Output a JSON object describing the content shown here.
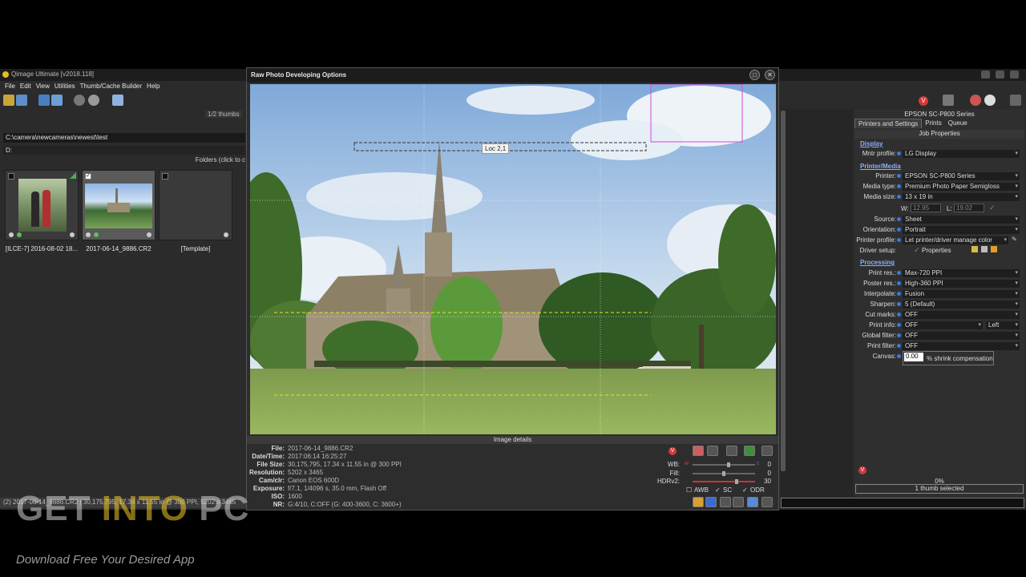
{
  "app": {
    "title": "Qimage Ultimate [v2018.118]",
    "menu": [
      "File",
      "Edit",
      "View",
      "Utilities",
      "Thumb/Cache Builder",
      "Help"
    ],
    "thumb_count": "1/2 thumbs",
    "path": "C:\\camera\\newcameras\\newest\\test",
    "drive": "D:",
    "folders_label": "Folders (click to c",
    "thumbs": [
      {
        "label": "[ILCE-7] 2016-08-02 18..."
      },
      {
        "label": "2017-06-14_9886.CR2"
      },
      {
        "label": "[Template]"
      }
    ],
    "status_line": "(2) 2017-06-14_9886.CR2 | 30,175,795, 17.34 x 11.55 in @ 300 PPI, 5202 x 3465"
  },
  "dialog": {
    "title": "Raw Photo Developing Options",
    "restore_icon": "□",
    "close_icon": "✕",
    "loc_tooltip": "Loc 2,1",
    "image_details_label": "Image details",
    "details": [
      {
        "label": "File:",
        "value": "2017-06-14_9886.CR2"
      },
      {
        "label": "Date/Time:",
        "value": "2017:06:14 16:25:27"
      },
      {
        "label": "File Size:",
        "value": "30,175,795, 17.34 x 11.55 in @ 300 PPI"
      },
      {
        "label": "Resolution:",
        "value": "5202 x 3465"
      },
      {
        "label": "Cam/clr:",
        "value": "Canon EOS 600D"
      },
      {
        "label": "Exposure:",
        "value": "f/7.1, 1/4096 s, 35.0 mm, Flash Off"
      },
      {
        "label": "ISO:",
        "value": "1600"
      },
      {
        "label": "NR:",
        "value": "G:4/10, C:OFF (G: 400-3600, C: 3600+)"
      }
    ],
    "sliders": [
      {
        "label": "WB:",
        "value": "0",
        "knob": 0.58
      },
      {
        "label": "Fill:",
        "value": "0",
        "knob": 0.5
      },
      {
        "label": "HDRv2:",
        "value": "30",
        "knob": 0.72
      }
    ],
    "options": [
      {
        "label": "AWB",
        "checked": false
      },
      {
        "label": "SC",
        "checked": true
      },
      {
        "label": "ODR",
        "checked": true
      }
    ]
  },
  "right": {
    "printer_name": "EPSON SC-P800 Series",
    "tabs": [
      "Printers and Settings",
      "Prints",
      "Queue"
    ],
    "job_properties": "Job Properties",
    "sections": {
      "display": "Display",
      "printer_media": "Printer/Media",
      "processing": "Processing"
    },
    "rows": {
      "mntr_profile": {
        "label": "Mntr profile:",
        "value": "LG Display"
      },
      "printer": {
        "label": "Printer:",
        "value": "EPSON SC-P800 Series"
      },
      "media_type": {
        "label": "Media type:",
        "value": "Premium Photo Paper Semigloss"
      },
      "media_size": {
        "label": "Media size:",
        "value": "13 x 19 in"
      },
      "w_label": "W:",
      "w_value": "12.95",
      "l_label": "L:",
      "l_value": "19.02",
      "source": {
        "label": "Source:",
        "value": "Sheet"
      },
      "orientation": {
        "label": "Orientation:",
        "value": "Portrait"
      },
      "printer_profile": {
        "label": "Printer profile:",
        "value": "Let printer/driver manage color"
      },
      "driver_setup": {
        "label": "Driver setup:",
        "value": "Properties"
      },
      "print_res": {
        "label": "Print res.:",
        "value": "Max-720 PPI"
      },
      "poster_res": {
        "label": "Poster res.:",
        "value": "High-360 PPI"
      },
      "interpolate": {
        "label": "Interpolate:",
        "value": "Fusion"
      },
      "sharpen": {
        "label": "Sharpen:",
        "value": "5 (Default)"
      },
      "cut_marks": {
        "label": "Cut marks:",
        "value": "OFF"
      },
      "print_info": {
        "label": "Print info:",
        "value": "OFF",
        "extra": "Left"
      },
      "global_filter": {
        "label": "Global filter:",
        "value": "OFF"
      },
      "print_filter": {
        "label": "Print filter:",
        "value": "OFF"
      },
      "canvas": {
        "label": "Canvas:",
        "value": "0.00",
        "suffix": "% shrink compensation"
      }
    },
    "progress": "0%",
    "thumb_selected": "1 thumb selected"
  },
  "watermark": {
    "get": "GET ",
    "into": "INTO",
    "pc": " PC",
    "tagline": "Download Free Your Desired App"
  }
}
